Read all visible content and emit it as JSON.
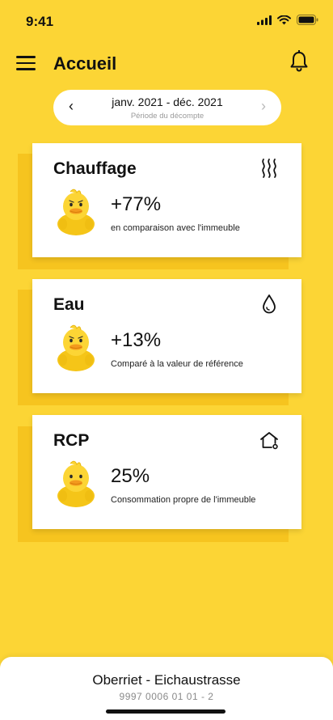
{
  "status_bar": {
    "time": "9:41"
  },
  "header": {
    "title": "Accueil",
    "menu_icon": "hamburger-icon",
    "bell_icon": "bell-icon"
  },
  "period": {
    "range": "janv. 2021 - déc. 2021",
    "caption": "Période du décompte",
    "prev": "‹",
    "next": "›"
  },
  "cards": [
    {
      "title": "Chauffage",
      "value": "+77%",
      "description": "en comparaison avec l'immeuble",
      "icon": "heating-icon"
    },
    {
      "title": "Eau",
      "value": "+13%",
      "description": "Comparé à la valeur de référence",
      "icon": "water-drop-icon"
    },
    {
      "title": "RCP",
      "value": "25%",
      "description": "Consommation propre de l'immeuble",
      "icon": "house-icon"
    }
  ],
  "footer": {
    "name": "Oberriet - Eichaustrasse",
    "id": "9997 0006 01 01 - 2"
  },
  "colors": {
    "background": "#FCD535",
    "card_shadow": "#F6C41F",
    "card": "#FFFFFF"
  }
}
